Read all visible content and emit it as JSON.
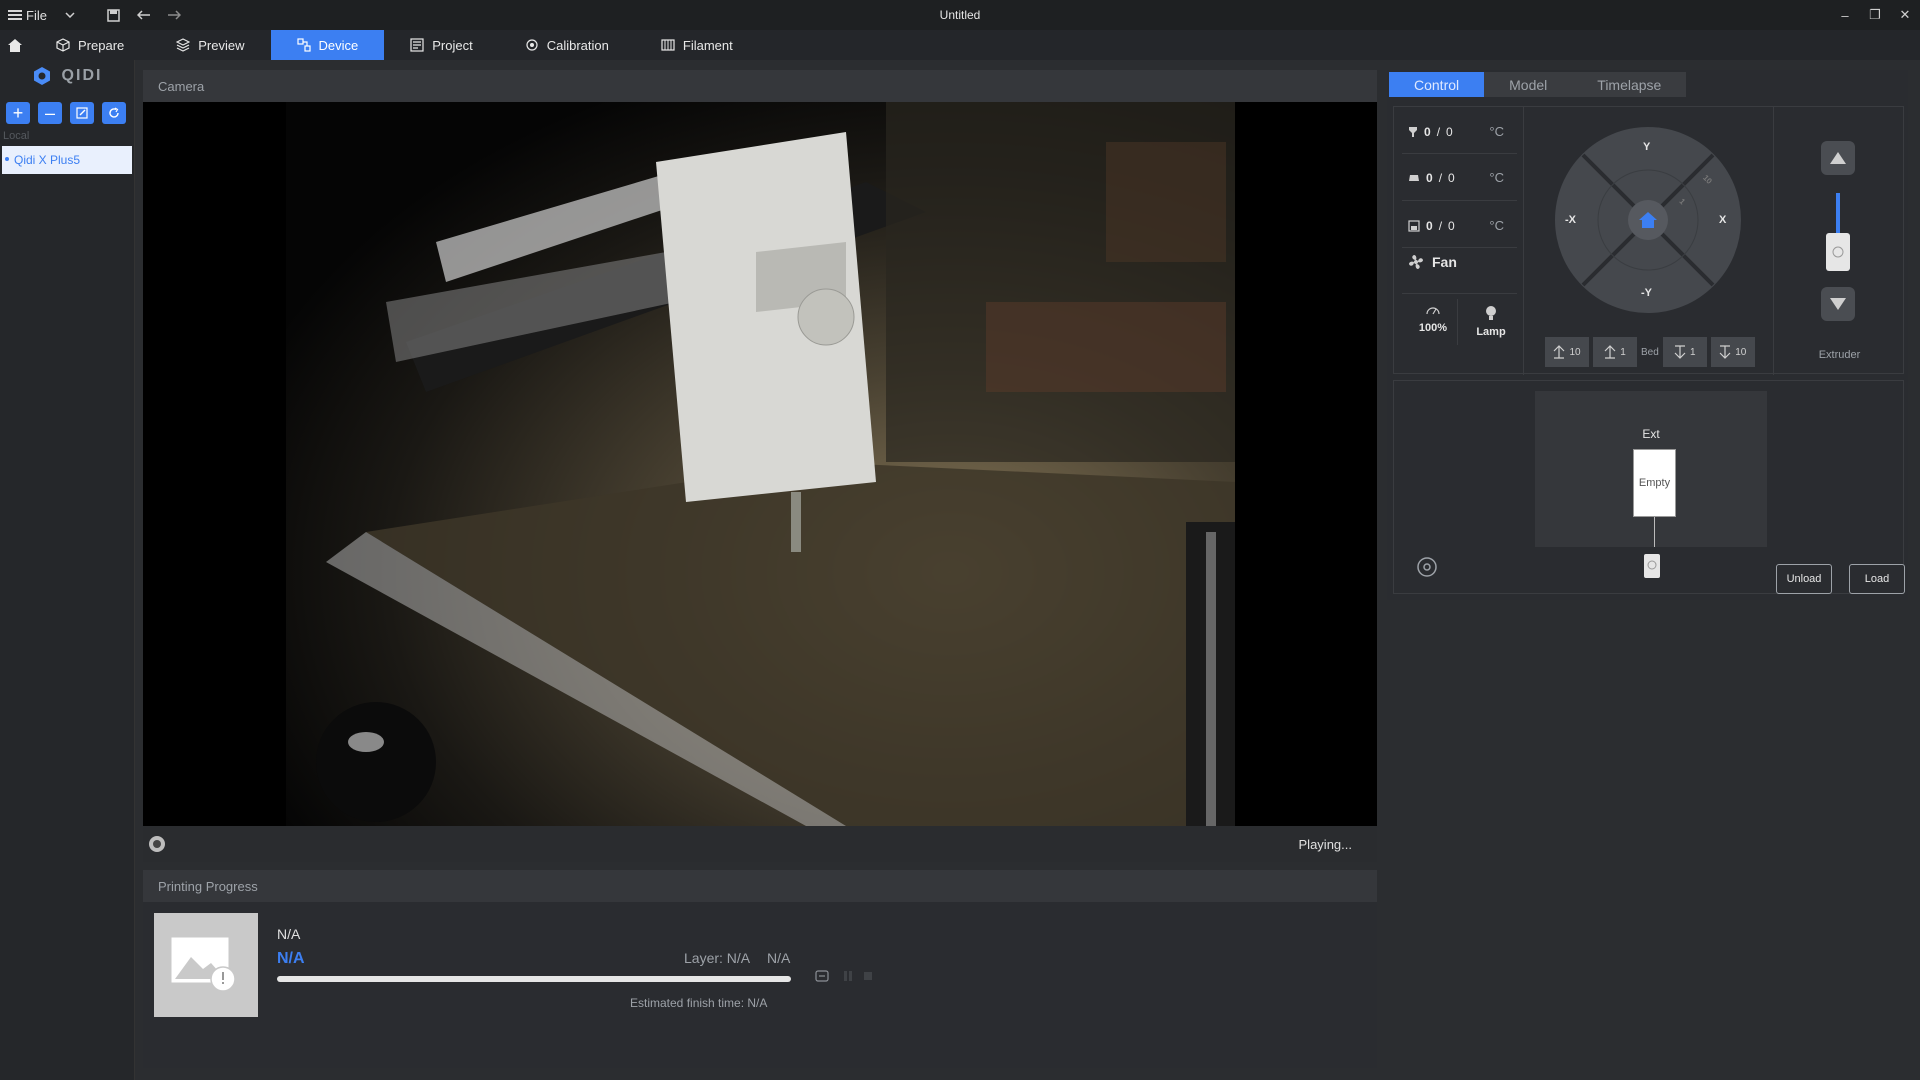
{
  "titlebar": {
    "menu_label": "File",
    "title": "Untitled"
  },
  "nav": {
    "tabs": [
      {
        "label": "Prepare",
        "icon": "cube-icon"
      },
      {
        "label": "Preview",
        "icon": "layers-icon"
      },
      {
        "label": "Device",
        "icon": "device-icon",
        "active": true
      },
      {
        "label": "Project",
        "icon": "project-icon"
      },
      {
        "label": "Calibration",
        "icon": "calibration-icon"
      },
      {
        "label": "Filament",
        "icon": "filament-icon"
      }
    ]
  },
  "sidebar": {
    "logo": "QIDI",
    "section_label": "Local",
    "printers": [
      "Qidi X Plus5"
    ]
  },
  "camera": {
    "header": "Camera",
    "status": "Playing..."
  },
  "progress": {
    "header": "Printing Progress",
    "name": "N/A",
    "status": "N/A",
    "layer": "Layer: N/A",
    "percent": "N/A",
    "finish": "Estimated finish time: N/A"
  },
  "control": {
    "tabs": [
      "Control",
      "Model",
      "Timelapse"
    ],
    "temps": [
      {
        "icon": "nozzle-icon",
        "value": "0",
        "target": "0",
        "unit": "°C"
      },
      {
        "icon": "bed-icon",
        "value": "0",
        "target": "0",
        "unit": "°C"
      },
      {
        "icon": "chamber-icon",
        "value": "0",
        "target": "0",
        "unit": "°C"
      }
    ],
    "fan_label": "Fan",
    "speed_label": "100%",
    "lamp_label": "Lamp",
    "jog": {
      "y_plus": "Y",
      "y_minus": "-Y",
      "x_plus": "X",
      "x_minus": "-X",
      "r10": "10",
      "r1": "1"
    },
    "bed": {
      "up10": "10",
      "up1": "1",
      "label": "Bed",
      "down1": "1",
      "down10": "10"
    },
    "extruder_label": "Extruder"
  },
  "ams": {
    "title": "Ext",
    "slot": "Empty",
    "unload": "Unload",
    "load": "Load"
  },
  "colors": {
    "accent": "#3c7ff2",
    "bg": "#2b2d30"
  }
}
